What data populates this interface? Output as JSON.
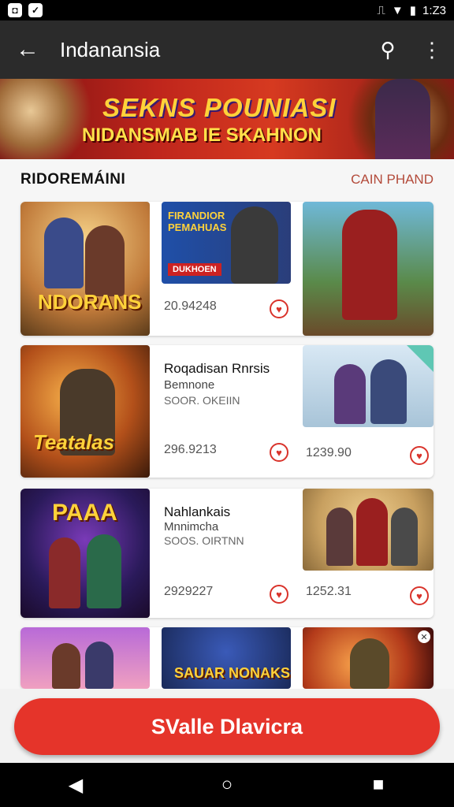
{
  "status_bar": {
    "left_icons": [
      "app-icon",
      "check-icon"
    ],
    "time": "1:Z3"
  },
  "app_bar": {
    "title": "Indanansia"
  },
  "banner": {
    "line1": "SEKNS POUNIASI",
    "line2": "NIDANSMAB IE SKAHNON"
  },
  "section": {
    "title": "RIDOREMÁINI",
    "link": "CAIN PHAND"
  },
  "row1": {
    "card_a": {
      "thumb_text": "NDORANS",
      "price": "20.94248"
    },
    "card_a2": {
      "banner_text": "FIRANDIOR PEMAHUAS",
      "badge": "DUKHOEN"
    }
  },
  "row2": {
    "card_a": {
      "thumb_text": "Teatalas",
      "title": "Roqadisan Rnrsis",
      "subtitle": "Bemnone",
      "meta": "SOOR. OKEIIN",
      "price": "296.9213"
    },
    "card_b": {
      "price": "1239.90"
    }
  },
  "row3": {
    "card_a": {
      "thumb_text": "PAAA",
      "title": "Nahlankais",
      "subtitle": "Mnnimcha",
      "meta": "SOOS. OIRTNN",
      "price": "2929227"
    },
    "card_b": {
      "price": "1252.31"
    }
  },
  "row4": {
    "card_b_text": "SAUAR NONAKS"
  },
  "cta": {
    "label": "SValle Dlavicra"
  },
  "colors": {
    "accent": "#e5342a",
    "app_bar": "#2b2b2b"
  }
}
